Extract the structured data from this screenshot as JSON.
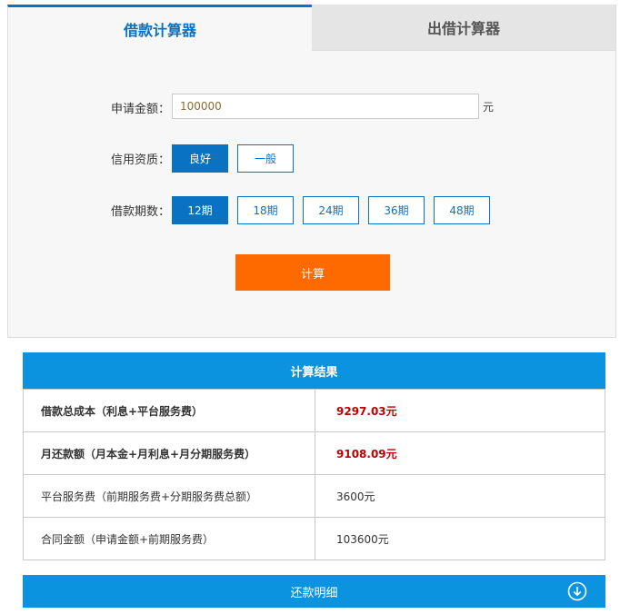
{
  "tabs": [
    {
      "label": "借款计算器",
      "active": true
    },
    {
      "label": "出借计算器",
      "active": false
    }
  ],
  "form": {
    "amount_label": "申请金额：",
    "amount_value": "100000",
    "amount_unit": "元",
    "credit_label": "信用资质：",
    "credit_options": [
      "良好",
      "一般"
    ],
    "credit_selected": "良好",
    "term_label": "借款期数：",
    "term_options": [
      "12期",
      "18期",
      "24期",
      "36期",
      "48期"
    ],
    "term_selected": "12期",
    "calculate_label": "计算"
  },
  "result": {
    "title": "计算结果",
    "rows": [
      {
        "label": "借款总成本（利息+平台服务费）",
        "value": "9297.03元",
        "emphasis": true
      },
      {
        "label": "月还款额（月本金+月利息+月分期服务费）",
        "value": "9108.09元",
        "emphasis": true
      },
      {
        "label": "平台服务费（前期服务费+分期服务费总额）",
        "value": "3600元",
        "emphasis": false
      },
      {
        "label": "合同金额（申请金额+前期服务费）",
        "value": "103600元",
        "emphasis": false
      }
    ]
  },
  "detail_bar": {
    "label": "还款明细",
    "icon": "arrow-down-circle-icon"
  },
  "colors": {
    "primary_blue": "#0a72c3",
    "header_blue": "#0c93df",
    "orange": "#ff6a00",
    "red_value": "#c00000"
  }
}
